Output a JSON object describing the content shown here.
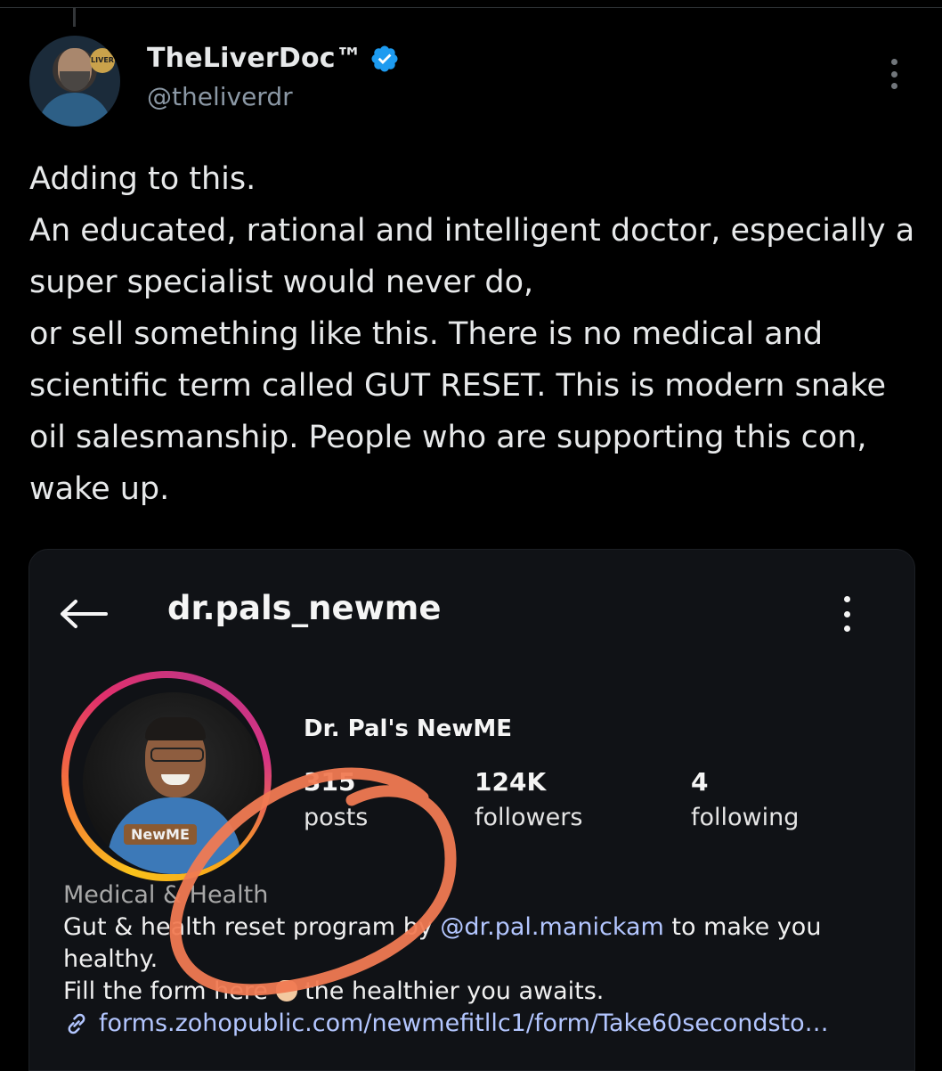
{
  "tweet": {
    "display_name": "TheLiverDoc™",
    "handle": "@theliverdr",
    "avatar_badge": "LIVER",
    "text": "Adding to this.\nAn educated, rational and intelligent doctor, especially a super specialist would never do,\nor sell something like this. There is no medical and scientific term called GUT RESET. This is modern snake oil salesmanship. People who are supporting this con, wake up.",
    "colors": {
      "background": "#000000",
      "verified": "#1d9bf0",
      "handle": "#8b98a5"
    }
  },
  "instagram": {
    "username": "dr.pals_newme",
    "full_name": "Dr. Pal's NewME",
    "profile_logo": "NewME",
    "stats": {
      "posts": {
        "value": "315",
        "label": "posts"
      },
      "followers": {
        "value": "124K",
        "label": "followers"
      },
      "following": {
        "value": "4",
        "label": "following"
      }
    },
    "bio": {
      "category": "Medical & Health",
      "line1_prefix": "Gut & health reset program by ",
      "mention": "@dr.pal.manickam",
      "line1_suffix": " to make you healthy.",
      "line2_prefix": "Fill the form here ",
      "line2_suffix": " the healthier you awaits.",
      "link": "forms.zohopublic.com/newmefitllc1/form/Take60secondsto…"
    },
    "annotation_color": "#f07a52"
  }
}
